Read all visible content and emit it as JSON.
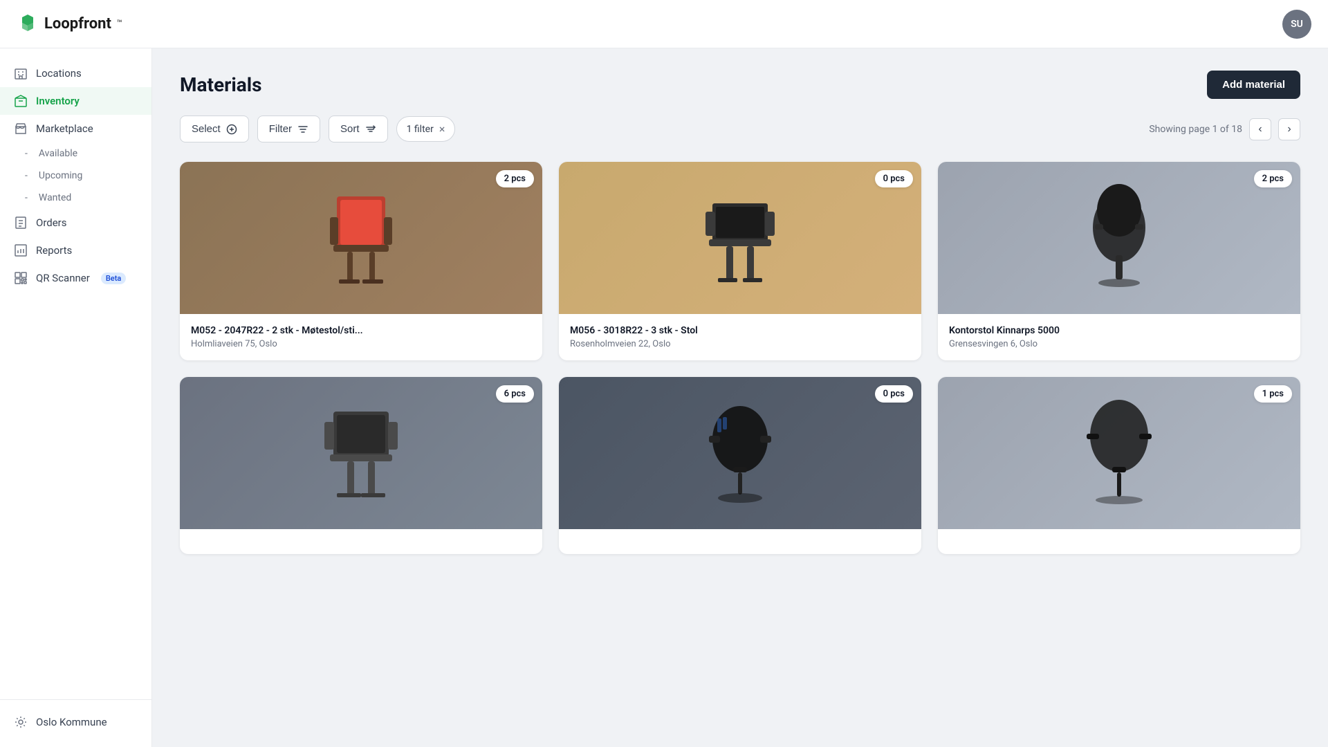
{
  "header": {
    "logo_text": "Loopfront",
    "logo_tm": "™",
    "user_initials": "SU"
  },
  "sidebar": {
    "items": [
      {
        "id": "locations",
        "label": "Locations",
        "icon": "building-icon",
        "active": false
      },
      {
        "id": "inventory",
        "label": "Inventory",
        "icon": "box-icon",
        "active": true
      },
      {
        "id": "marketplace",
        "label": "Marketplace",
        "icon": "store-icon",
        "active": false
      }
    ],
    "marketplace_sub": [
      {
        "id": "available",
        "label": "Available"
      },
      {
        "id": "upcoming",
        "label": "Upcoming"
      },
      {
        "id": "wanted",
        "label": "Wanted"
      }
    ],
    "bottom_items": [
      {
        "id": "orders",
        "label": "Orders",
        "icon": "orders-icon"
      },
      {
        "id": "reports",
        "label": "Reports",
        "icon": "reports-icon"
      },
      {
        "id": "qr-scanner",
        "label": "QR Scanner",
        "icon": "qr-icon",
        "badge": "Beta"
      }
    ],
    "org_label": "Oslo Kommune",
    "org_icon": "settings-icon"
  },
  "main": {
    "page_title": "Materials",
    "add_button_label": "Add material",
    "toolbar": {
      "select_label": "Select",
      "filter_label": "Filter",
      "sort_label": "Sort",
      "active_filter": "1 filter"
    },
    "pagination": {
      "label": "Showing page 1 of 18",
      "current_page": 1,
      "total_pages": 18
    },
    "cards": [
      {
        "id": "card-1",
        "title": "M052 - 2047R22 - 2 stk - Møtestol/sti...",
        "location": "Holmliaveien 75, Oslo",
        "pcs": "2 pcs",
        "bg_class": "chair-red"
      },
      {
        "id": "card-2",
        "title": "M056 - 3018R22 - 3 stk - Stol",
        "location": "Rosenholmveien 22, Oslo",
        "pcs": "0 pcs",
        "bg_class": "chair-black1"
      },
      {
        "id": "card-3",
        "title": "Kontorstol Kinnarps 5000",
        "location": "Grensesvingen 6, Oslo",
        "pcs": "2 pcs",
        "bg_class": "chair-office"
      },
      {
        "id": "card-4",
        "title": "",
        "location": "",
        "pcs": "6 pcs",
        "bg_class": "chair-gray"
      },
      {
        "id": "card-5",
        "title": "",
        "location": "",
        "pcs": "0 pcs",
        "bg_class": "chair-ergonomic"
      },
      {
        "id": "card-6",
        "title": "",
        "location": "",
        "pcs": "1 pcs",
        "bg_class": "chair-black2"
      }
    ]
  }
}
